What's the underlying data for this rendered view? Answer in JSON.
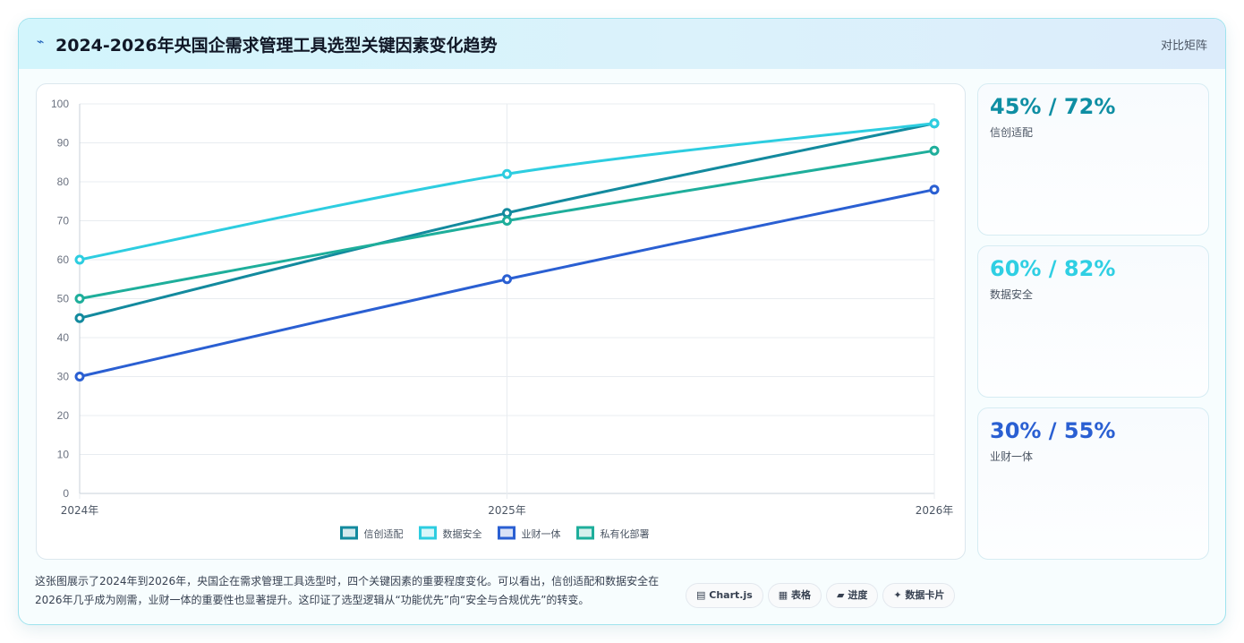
{
  "header": {
    "icon": "trend-icon",
    "title": "2024-2026年央国企需求管理工具选型关键因素变化趋势",
    "action_label": "对比矩阵"
  },
  "chart_data": {
    "type": "line",
    "categories": [
      "2024年",
      "2025年",
      "2026年"
    ],
    "ylim": [
      0,
      100
    ],
    "yticks": [
      0,
      10,
      20,
      30,
      40,
      50,
      60,
      70,
      80,
      90,
      100
    ],
    "grid": true,
    "legend_position": "bottom",
    "series": [
      {
        "name": "信创适配",
        "values": [
          45,
          72,
          95
        ],
        "color": "#138a9e"
      },
      {
        "name": "数据安全",
        "values": [
          60,
          82,
          95
        ],
        "color": "#2dcde0"
      },
      {
        "name": "业财一体",
        "values": [
          30,
          55,
          78
        ],
        "color": "#2a5fd2"
      },
      {
        "name": "私有化部署",
        "values": [
          50,
          70,
          88
        ],
        "color": "#1eae9b"
      }
    ]
  },
  "stats": [
    {
      "value": "45% / 72%",
      "label": "信创适配",
      "color": "#0e8ea3"
    },
    {
      "value": "60% / 82%",
      "label": "数据安全",
      "color": "#2fcfe3"
    },
    {
      "value": "30% / 55%",
      "label": "业财一体",
      "color": "#2a5fd2"
    }
  ],
  "description": "这张图展示了2024年到2026年，央国企在需求管理工具选型时，四个关键因素的重要程度变化。可以看出，信创适配和数据安全在2026年几乎成为刚需，业财一体的重要性也显著提升。这印证了选型逻辑从“功能优先”向“安全与合规优先”的转变。",
  "chips": [
    {
      "icon": "chart-icon",
      "glyph": "▤",
      "label": "Chart.js"
    },
    {
      "icon": "table-icon",
      "glyph": "▦",
      "label": "表格"
    },
    {
      "icon": "progress-icon",
      "glyph": "▰",
      "label": "进度"
    },
    {
      "icon": "sparkle-icon",
      "glyph": "✦",
      "label": "数据卡片"
    }
  ]
}
